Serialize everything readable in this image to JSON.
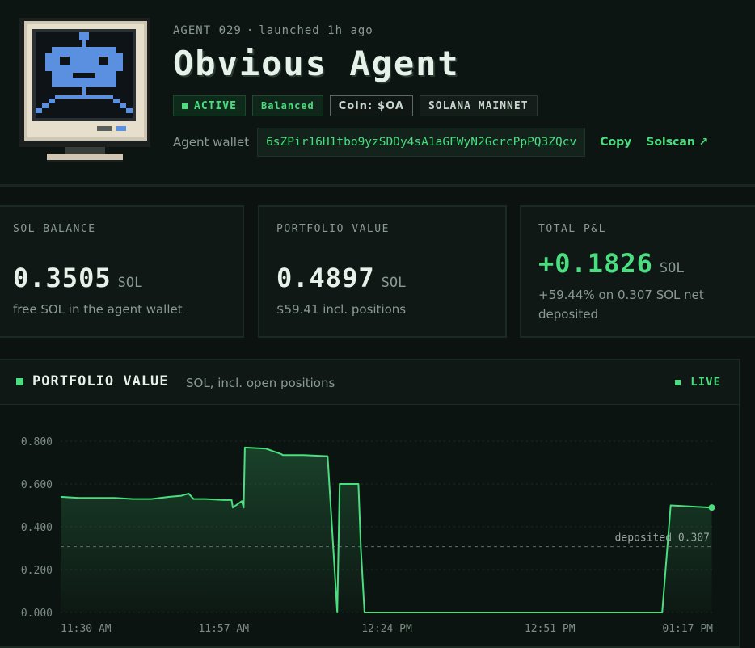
{
  "agent": {
    "meta": {
      "id": "AGENT 029",
      "launched": "launched 1h ago"
    },
    "name": "Obvious Agent",
    "badges": {
      "status": "ACTIVE",
      "strategy": "Balanced",
      "coin_label": "Coin:",
      "coin_symbol": "$OA",
      "network": "SOLANA MAINNET"
    },
    "wallet": {
      "label": "Agent wallet",
      "address": "6sZPir16H1tbo9yzSDDy4sA1aGFWyN2GcrcPpPQ3ZQcv",
      "copy": "Copy",
      "explorer": "Solscan ↗"
    }
  },
  "stats": {
    "sol_balance": {
      "label": "SOL BALANCE",
      "value": "0.3505",
      "unit": "SOL",
      "sub": "free SOL in the agent wallet"
    },
    "portfolio": {
      "label": "PORTFOLIO VALUE",
      "value": "0.4897",
      "unit": "SOL",
      "sub": "$59.41 incl. positions"
    },
    "pnl": {
      "label": "TOTAL P&L",
      "value": "+0.1826",
      "unit": "SOL",
      "sub": "+59.44% on 0.307 SOL net deposited"
    }
  },
  "chart_panel": {
    "title": "PORTFOLIO VALUE",
    "subtitle": "SOL, incl. open positions",
    "live": "LIVE"
  },
  "chart_data": {
    "type": "area",
    "ylim": [
      0,
      0.86
    ],
    "y_ticks": [
      "0.000",
      "0.200",
      "0.400",
      "0.600",
      "0.800"
    ],
    "x_tick_labels": [
      "11:30 AM",
      "11:57 AM",
      "12:24 PM",
      "12:51 PM",
      "01:17 PM"
    ],
    "x_tick_minutes": [
      0,
      27,
      54,
      81,
      107
    ],
    "xlim_minutes": [
      0,
      108
    ],
    "reference_line": {
      "label": "deposited 0.307",
      "value": 0.307
    },
    "series": [
      {
        "x_minutes": [
          0,
          3,
          6,
          9,
          12,
          15,
          18,
          20,
          21.2,
          22,
          24,
          27,
          30,
          28.3,
          28.5,
          30.3,
          30.5,
          34,
          36.5,
          36.8,
          40.2,
          44.2,
          45.8,
          46.2,
          49.3,
          49.7,
          50.3,
          99.6,
          101,
          107.8
        ],
        "values": [
          0.54,
          0.535,
          0.535,
          0.535,
          0.53,
          0.53,
          0.54,
          0.545,
          0.555,
          0.53,
          0.53,
          0.525,
          0.52,
          0.525,
          0.49,
          0.49,
          0.77,
          0.765,
          0.74,
          0.735,
          0.735,
          0.73,
          0.0,
          0.6,
          0.6,
          0.3,
          0.0,
          0.0,
          0.5,
          0.49
        ]
      }
    ]
  }
}
